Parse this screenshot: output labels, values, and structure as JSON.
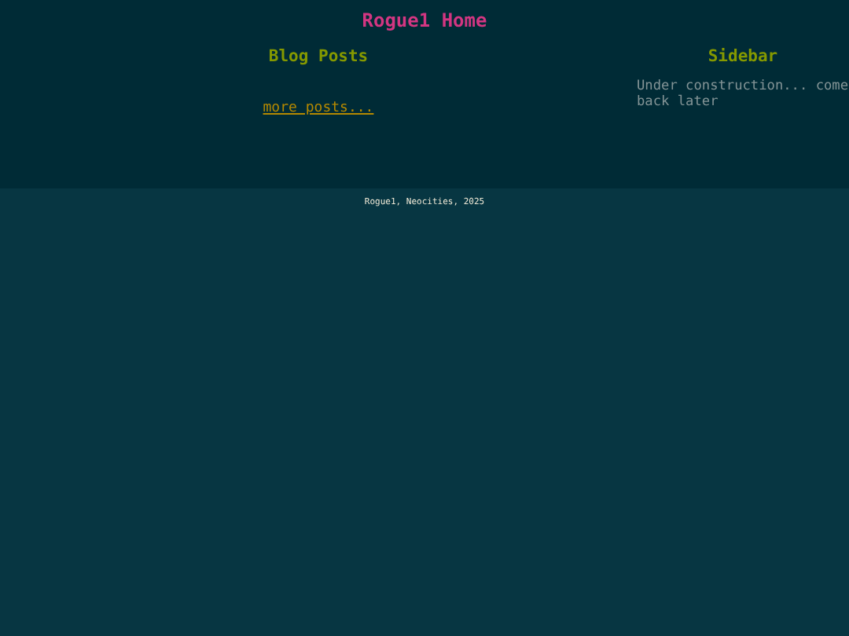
{
  "header": {
    "title": "Rogue1 Home"
  },
  "main": {
    "heading": "Blog Posts",
    "more_link": "more posts..."
  },
  "sidebar": {
    "heading": "Sidebar",
    "text": "Under construction... come back later"
  },
  "footer": {
    "text": "Rogue1, Neocities, 2025"
  }
}
